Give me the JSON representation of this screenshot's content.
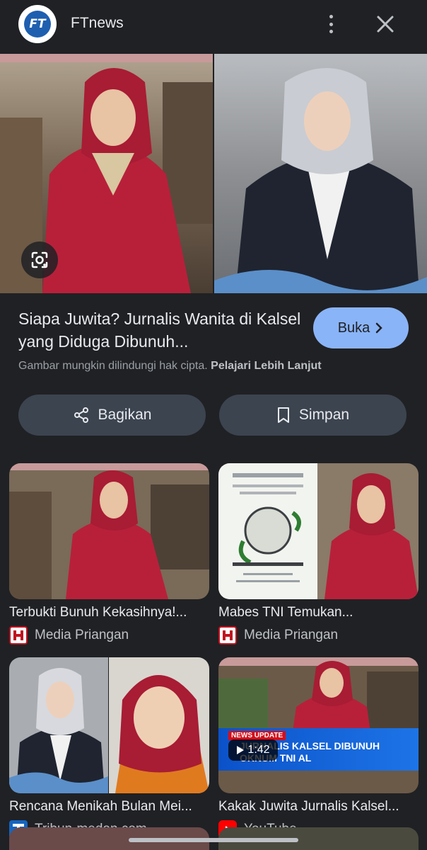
{
  "header": {
    "site_name": "FTnews",
    "logo_text": "FT",
    "menu_icon": "more-vert-icon",
    "close_icon": "close-icon"
  },
  "preview": {
    "lens_icon": "google-lens-icon",
    "title": "Siapa Juwita? Jurnalis Wanita di Kalsel yang Diduga Dibunuh...",
    "open_button": "Buka",
    "copyright_text": "Gambar mungkin dilindungi hak cipta.",
    "learn_more": "Pelajari Lebih Lanjut",
    "share_button": "Bagikan",
    "save_button": "Simpan"
  },
  "results": [
    {
      "title": "Terbukti Bunuh Kekasihnya!...",
      "source": "Media Priangan",
      "source_icon": "media-priangan-icon"
    },
    {
      "title": "Mabes TNI Temukan...",
      "source": "Media Priangan",
      "source_icon": "media-priangan-icon"
    },
    {
      "title": "Rencana Menikah Bulan Mei...",
      "source": "Tribun-medan.com -...",
      "source_icon": "tribun-icon"
    },
    {
      "title": "Kakak Juwita Jurnalis Kalsel...",
      "source": "YouTube",
      "source_icon": "youtube-icon",
      "duration": "1:42",
      "news_tag": "NEWS UPDATE",
      "news_headline": "JURNALIS KALSEL DIBUNUH OKNUM TNI AL"
    }
  ],
  "colors": {
    "background": "#202124",
    "accent": "#8ab4f8",
    "button_bg": "#3c4450",
    "text_primary": "#e8eaed",
    "text_secondary": "#9aa0a6"
  }
}
